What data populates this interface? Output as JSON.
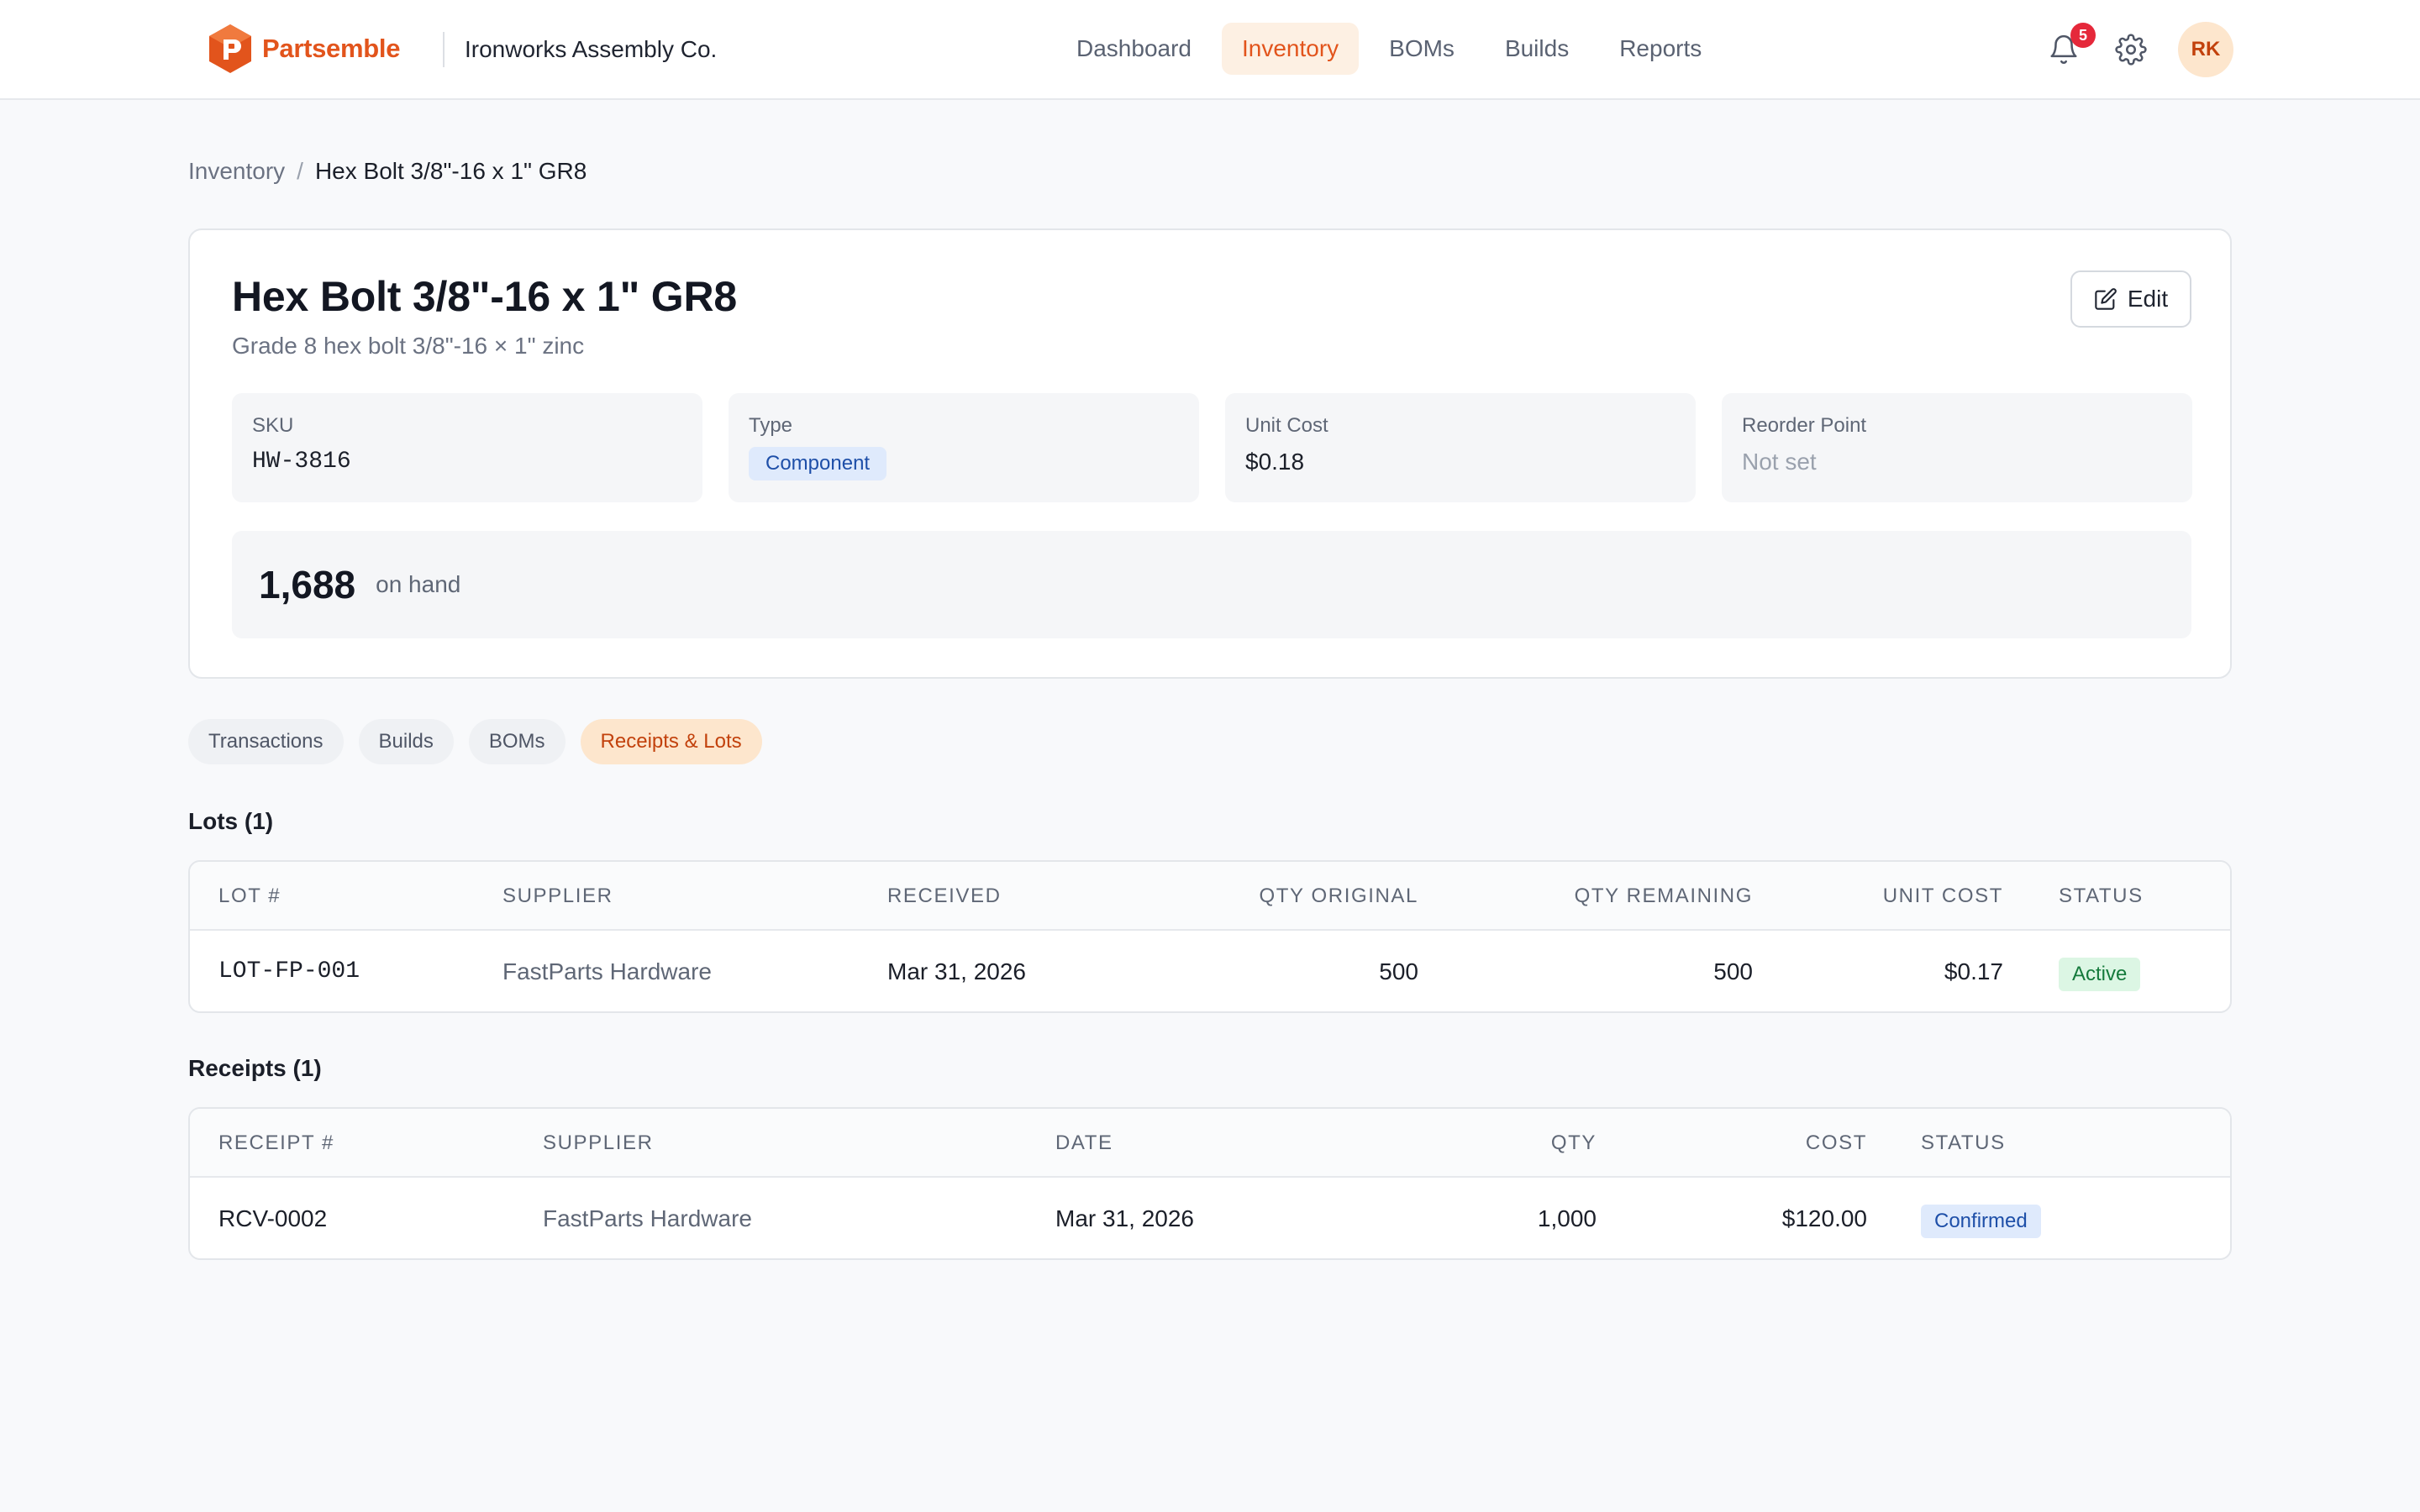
{
  "app": {
    "brand_name": "Partsemble",
    "org_name": "Ironworks Assembly Co.",
    "accent_color": "#e2541c"
  },
  "nav": {
    "items": [
      {
        "label": "Dashboard",
        "active": false
      },
      {
        "label": "Inventory",
        "active": true
      },
      {
        "label": "BOMs",
        "active": false
      },
      {
        "label": "Builds",
        "active": false
      },
      {
        "label": "Reports",
        "active": false
      }
    ]
  },
  "header_icons": {
    "notifications_icon": "bell-icon",
    "notifications_count": "5",
    "settings_icon": "gear-icon",
    "user_initials": "RK"
  },
  "breadcrumb": {
    "parent": "Inventory",
    "separator": "/",
    "current": "Hex Bolt 3/8\"-16 x 1\" GR8"
  },
  "item": {
    "title": "Hex Bolt 3/8\"-16 x 1\" GR8",
    "description": "Grade 8 hex bolt 3/8\"-16 × 1\" zinc",
    "edit_label": "Edit",
    "edit_icon": "pencil-square-icon",
    "sku_label": "SKU",
    "sku": "HW-3816",
    "type_label": "Type",
    "type": "Component",
    "unit_cost_label": "Unit Cost",
    "unit_cost": "$0.18",
    "reorder_label": "Reorder Point",
    "reorder_value": "Not set",
    "on_hand": "1,688",
    "on_hand_label": "on hand"
  },
  "tabs": [
    {
      "label": "Transactions",
      "active": false
    },
    {
      "label": "Builds",
      "active": false
    },
    {
      "label": "BOMs",
      "active": false
    },
    {
      "label": "Receipts & Lots",
      "active": true
    }
  ],
  "lots": {
    "title": "Lots (1)",
    "columns": [
      "Lot #",
      "Supplier",
      "Received",
      "Qty Original",
      "Qty Remaining",
      "Unit Cost",
      "Status"
    ],
    "rows": [
      {
        "lot": "LOT-FP-001",
        "supplier": "FastParts Hardware",
        "received": "Mar 31, 2026",
        "qty_original": "500",
        "qty_remaining": "500",
        "unit_cost": "$0.17",
        "status": "Active"
      }
    ]
  },
  "receipts": {
    "title": "Receipts (1)",
    "columns": [
      "Receipt #",
      "Supplier",
      "Date",
      "Qty",
      "Cost",
      "Status"
    ],
    "rows": [
      {
        "receipt": "RCV-0002",
        "supplier": "FastParts Hardware",
        "date": "Mar 31, 2026",
        "qty": "1,000",
        "cost": "$120.00",
        "status": "Confirmed"
      }
    ]
  }
}
